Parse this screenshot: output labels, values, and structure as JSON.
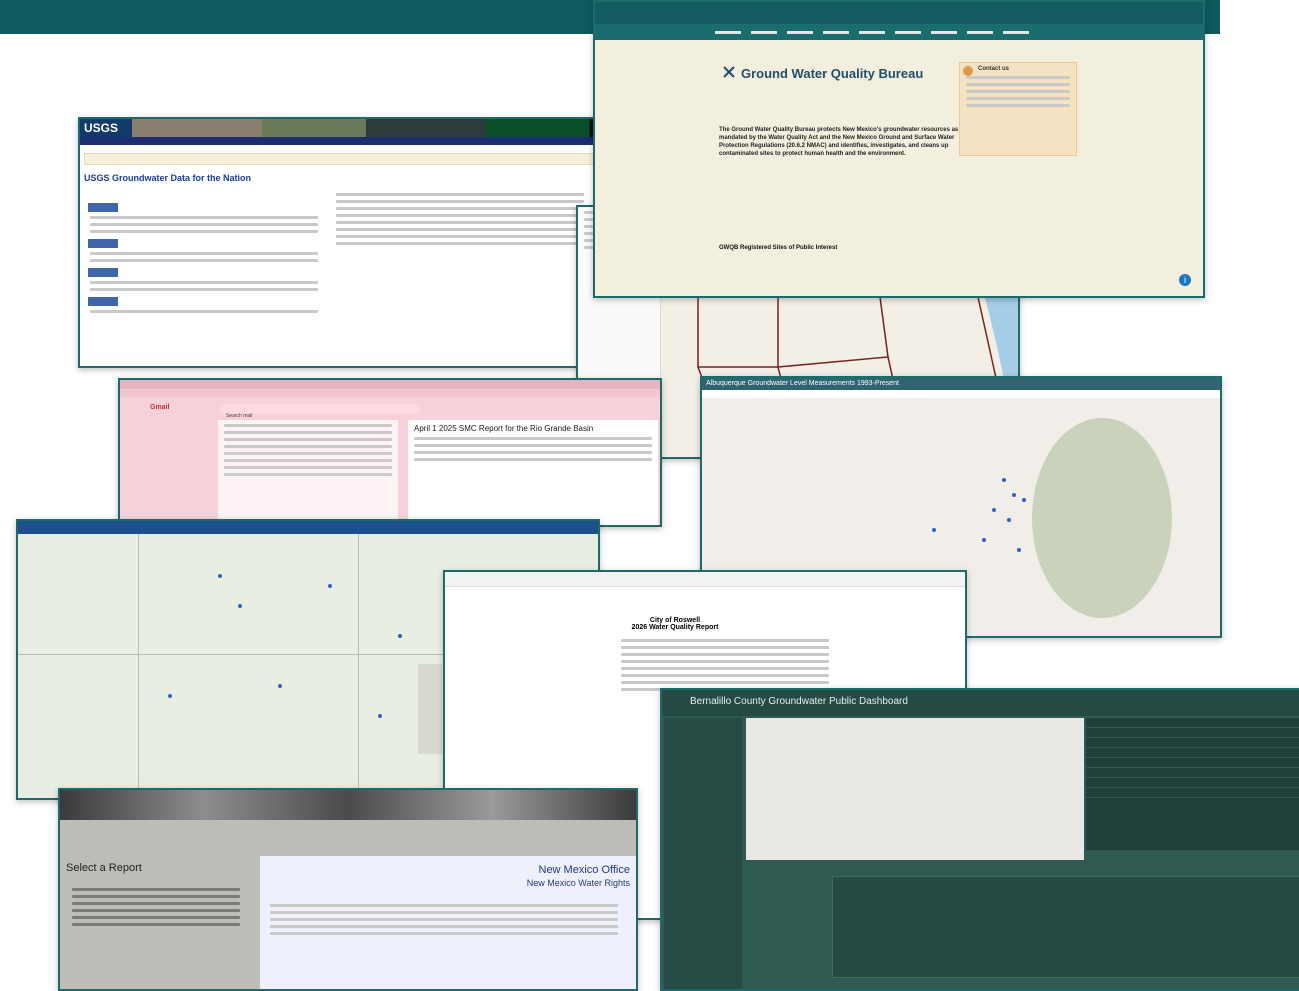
{
  "usgs": {
    "logo": "USGS",
    "title": "USGS Groundwater Data for the Nation"
  },
  "nmed": {
    "page_title": "Ground Water Quality Bureau",
    "intro": "The Ground Water Quality Bureau protects New Mexico's groundwater resources as mandated by the Water Quality Act and the New Mexico Ground and Surface Water Protection Regulations (20.6.2 NMAC) and identifies, investigates, and cleans up contaminated sites to protect human health and the environment.",
    "contact_heading": "Contact us",
    "section_heading": "GWQB Registered Sites of Public Interest"
  },
  "gmail": {
    "app": "Gmail",
    "search_placeholder": "Search mail",
    "message_subject": "April 1 2025 SMC Report for the Rio Grande Basin"
  },
  "abq": {
    "window_title": "Albuquerque Groundwater Level Measurements 1993-Present"
  },
  "roswell": {
    "heading": "City of Roswell",
    "subheading": "2026 Water Quality Report"
  },
  "ose": {
    "sidebar_title": "Select a Report",
    "main_title": "New Mexico Office",
    "main_subtitle": "New Mexico Water Rights"
  },
  "bern": {
    "title": "Bernalillo County Groundwater Public Dashboard"
  },
  "colors": {
    "teal": "#0f5a5f",
    "usgs_blue": "#1a3b9c",
    "gmail_pink": "#f6d1da",
    "dashboard_green": "#2f5a52"
  }
}
